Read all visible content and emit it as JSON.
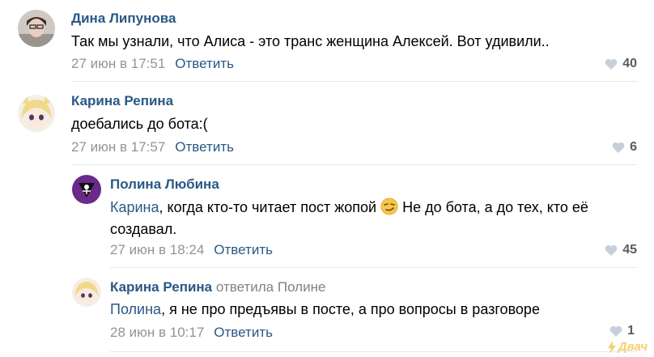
{
  "comments": [
    {
      "author": "Дина Липунова",
      "text": "Так мы узнали, что Алиса - это транс женщина Алексей. Вот удивили..",
      "date": "27 июн в 17:51",
      "reply_label": "Ответить",
      "likes": "40"
    },
    {
      "author": "Карина Репина",
      "text": "доебались до бота:(",
      "date": "27 июн в 17:57",
      "reply_label": "Ответить",
      "likes": "6"
    },
    {
      "author": "Полина Любина",
      "mention": "Карина",
      "text_part1": ", когда кто-то читает пост жопой ",
      "text_part2": " Не до бота, а до тех, кто её",
      "text_line2": "создавал.",
      "date": "27 июн в 18:24",
      "reply_label": "Ответить",
      "likes": "45"
    },
    {
      "author": "Карина Репина",
      "replied_to": "ответила Полине",
      "mention": "Полина",
      "text": ", я не про предъявы в посте, а про вопросы в разговоре",
      "date": "28 июн в 10:17",
      "reply_label": "Ответить",
      "likes": "1"
    }
  ],
  "watermark": "Двач",
  "colors": {
    "link": "#2a5885",
    "meta": "#939393",
    "divider": "#e7e8ec",
    "watermark": "#f4c24a"
  },
  "icons": [
    "heart-icon",
    "smirk-emoji-icon",
    "lightning-icon"
  ]
}
